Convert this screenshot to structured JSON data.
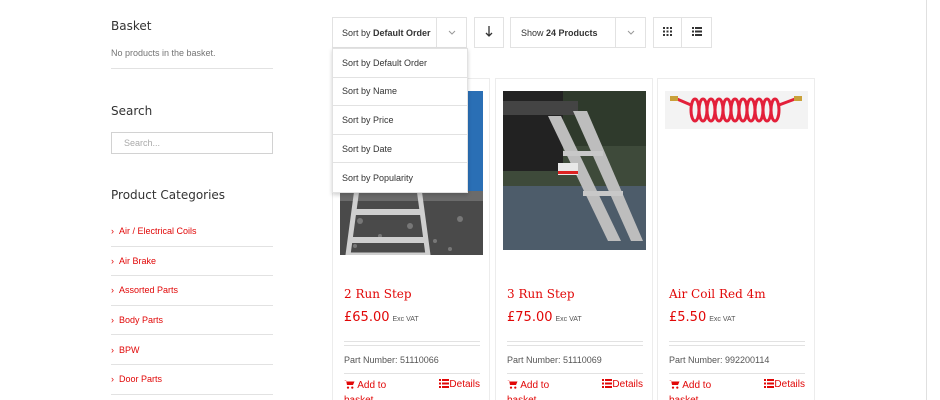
{
  "sidebar": {
    "basket": {
      "title": "Basket",
      "empty_text": "No products in the basket."
    },
    "search": {
      "title": "Search",
      "placeholder": "Search..."
    },
    "categories": {
      "title": "Product Categories",
      "items": [
        {
          "label": "Air / Electrical Coils"
        },
        {
          "label": "Air Brake"
        },
        {
          "label": "Assorted Parts"
        },
        {
          "label": "Body Parts"
        },
        {
          "label": "BPW"
        },
        {
          "label": "Door Parts"
        }
      ]
    }
  },
  "toolbar": {
    "sort": {
      "prefix": "Sort by",
      "value": "Default Order"
    },
    "direction_icon": "arrow-down-icon",
    "show": {
      "prefix": "Show",
      "value": "24 Products"
    },
    "view_grid_icon": "grid-icon",
    "view_list_icon": "list-icon"
  },
  "sort_dropdown": {
    "options": [
      {
        "label": "Sort by Default Order"
      },
      {
        "label": "Sort by Name"
      },
      {
        "label": "Sort by Price"
      },
      {
        "label": "Sort by Date"
      },
      {
        "label": "Sort by Popularity"
      }
    ]
  },
  "products": [
    {
      "title": "2 Run Step",
      "price": "£65.00",
      "vat": "Exc VAT",
      "part_number": "Part Number: 51110066",
      "add_label": "Add to basket",
      "details_label": "Details"
    },
    {
      "title": "3 Run Step",
      "price": "£75.00",
      "vat": "Exc VAT",
      "part_number": "Part Number: 51110069",
      "add_label": "Add to basket",
      "details_label": "Details"
    },
    {
      "title": "Air Coil Red 4m",
      "price": "£5.50",
      "vat": "Exc VAT",
      "part_number": "Part Number: 992200114",
      "add_label": "Add to basket",
      "details_label": "Details"
    }
  ],
  "colors": {
    "accent": "#e10707",
    "border": "#e2e2e2"
  }
}
